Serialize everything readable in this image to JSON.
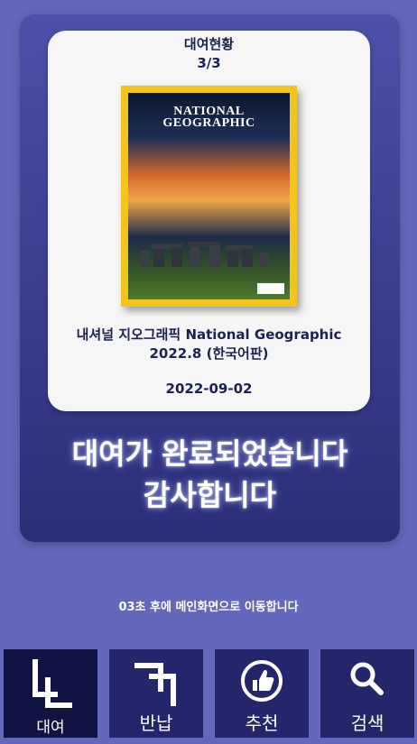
{
  "rental": {
    "status_label": "대여현황",
    "status_count": "3/3",
    "book": {
      "cover_title_line1": "NATIONAL",
      "cover_title_line2": "GEOGRAPHIC",
      "title_line1": "내셔널 지오그래픽 National Geographic",
      "title_line2": "2022.8 (한국어판)"
    },
    "date": "2022-09-02"
  },
  "message": {
    "line1": "대여가 완료되었습니다",
    "line2": "감사합니다"
  },
  "countdown": "03초 후에 메인화면으로 이동합니다",
  "nav": {
    "rent": {
      "label": "대여",
      "icon": "rent-icon"
    },
    "return": {
      "label": "반납",
      "icon": "return-icon"
    },
    "recommend": {
      "label": "추천",
      "icon": "thumbs-up-icon"
    },
    "search": {
      "label": "검색",
      "icon": "search-icon"
    }
  },
  "colors": {
    "background": "#6468bd",
    "panel": "#2a2e78",
    "nav_button": "#23266a",
    "nav_active": "#111342",
    "cover_border": "#f2c51c"
  }
}
